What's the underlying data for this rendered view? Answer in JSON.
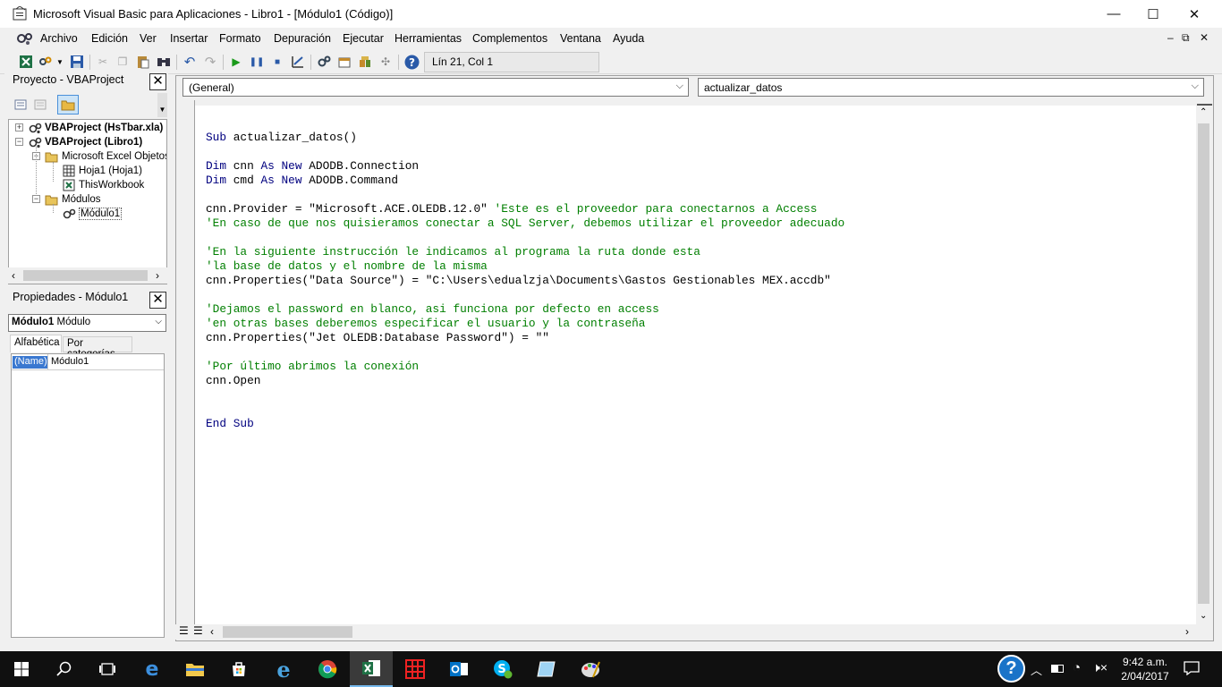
{
  "window": {
    "title": "Microsoft Visual Basic para Aplicaciones - Libro1 - [Módulo1 (Código)]",
    "controls": {
      "minimize": "—",
      "maximize": "☐",
      "close": "✕"
    }
  },
  "menu": {
    "items": [
      "Archivo",
      "Edición",
      "Ver",
      "Insertar",
      "Formato",
      "Depuración",
      "Ejecutar",
      "Herramientas",
      "Complementos",
      "Ventana",
      "Ayuda"
    ],
    "mdi": {
      "minimize": "–",
      "restore": "⧉",
      "close": "✕"
    }
  },
  "toolbar": {
    "position": "Lín 21, Col 1"
  },
  "project_panel": {
    "title": "Proyecto - VBAProject",
    "close": "✕",
    "tree": [
      {
        "label": "VBAProject (HsTbar.xla)",
        "bold": true
      },
      {
        "label": "VBAProject (Libro1)",
        "bold": true
      },
      {
        "label": "Microsoft Excel Objetos"
      },
      {
        "label": "Hoja1 (Hoja1)"
      },
      {
        "label": "ThisWorkbook"
      },
      {
        "label": "Módulos"
      },
      {
        "label": "Módulo1"
      }
    ]
  },
  "properties_panel": {
    "title": "Propiedades - Módulo1",
    "close": "✕",
    "object_name": "Módulo1",
    "object_type": "Módulo",
    "tabs": [
      "Alfabética",
      "Por categorías"
    ],
    "rows": [
      {
        "name": "(Name)",
        "value": "Módulo1"
      }
    ]
  },
  "code_window": {
    "object_combo": "(General)",
    "procedure_combo": "actualizar_datos",
    "lines": [
      [
        {
          "t": "Sub",
          "k": "kw"
        },
        {
          "t": " actualizar_datos()"
        }
      ],
      [],
      [
        {
          "t": "Dim",
          "k": "kw"
        },
        {
          "t": " cnn "
        },
        {
          "t": "As",
          "k": "kw"
        },
        {
          "t": " "
        },
        {
          "t": "New",
          "k": "kw"
        },
        {
          "t": " ADODB.Connection"
        }
      ],
      [
        {
          "t": "Dim",
          "k": "kw"
        },
        {
          "t": " cmd "
        },
        {
          "t": "As",
          "k": "kw"
        },
        {
          "t": " "
        },
        {
          "t": "New",
          "k": "kw"
        },
        {
          "t": " ADODB.Command"
        }
      ],
      [],
      [
        {
          "t": "cnn.Provider = \"Microsoft.ACE.OLEDB.12.0\" "
        },
        {
          "t": "'Este es el proveedor para conectarnos a Access",
          "k": "cm"
        }
      ],
      [
        {
          "t": "'En caso de que nos quisieramos conectar a SQL Server, debemos utilizar el proveedor adecuado",
          "k": "cm"
        }
      ],
      [],
      [
        {
          "t": "'En la siguiente instrucción le indicamos al programa la ruta donde esta",
          "k": "cm"
        }
      ],
      [
        {
          "t": "'la base de datos y el nombre de la misma",
          "k": "cm"
        }
      ],
      [
        {
          "t": "cnn.Properties(\"Data Source\") = \"C:\\Users\\edualzja\\Documents\\Gastos Gestionables MEX.accdb\""
        }
      ],
      [],
      [
        {
          "t": "'Dejamos el password en blanco, asi funciona por defecto en access",
          "k": "cm"
        }
      ],
      [
        {
          "t": "'en otras bases deberemos especificar el usuario y la contraseña",
          "k": "cm"
        }
      ],
      [
        {
          "t": "cnn.Properties(\"Jet OLEDB:Database Password\") = \"\""
        }
      ],
      [],
      [
        {
          "t": "'Por último abrimos la conexión",
          "k": "cm"
        }
      ],
      [
        {
          "t": "cnn.Open"
        }
      ],
      [],
      [],
      [
        {
          "t": "End",
          "k": "kw"
        },
        {
          "t": " "
        },
        {
          "t": "Sub",
          "k": "kw"
        }
      ]
    ]
  },
  "taskbar": {
    "clock": {
      "time": "9:42 a.m.",
      "date": "2/04/2017"
    },
    "colors": {
      "background": "#101010",
      "accent": "#76b9ed"
    }
  },
  "colors": {
    "keyword": "#00007f",
    "comment": "#007f00"
  }
}
